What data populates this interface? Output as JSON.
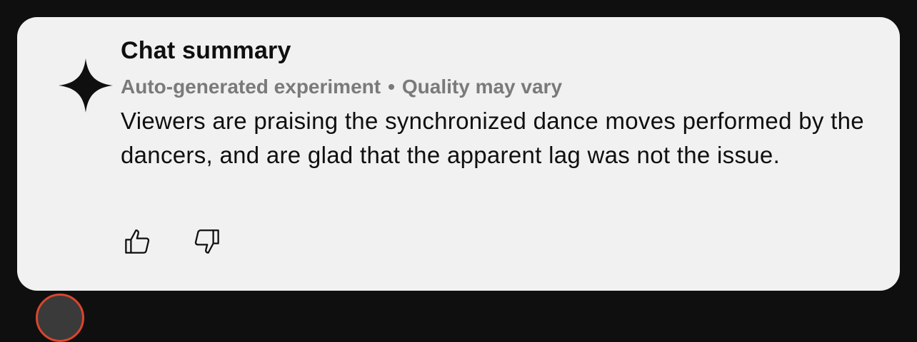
{
  "summary": {
    "title": "Chat summary",
    "subtitle_left": "Auto-generated experiment",
    "subtitle_sep": "•",
    "subtitle_right": "Quality may vary",
    "text": "Viewers are praising the synchronized dance moves performed by the dancers, and are glad that the apparent lag was not the issue.",
    "icon": "sparkle-icon"
  },
  "feedback": {
    "like_icon": "thumbs-up-icon",
    "dislike_icon": "thumbs-down-icon"
  },
  "colors": {
    "background": "#0f0f0f",
    "card": "#f1f1f1",
    "text": "#0f0f0f",
    "muted": "#7a7a7a"
  }
}
